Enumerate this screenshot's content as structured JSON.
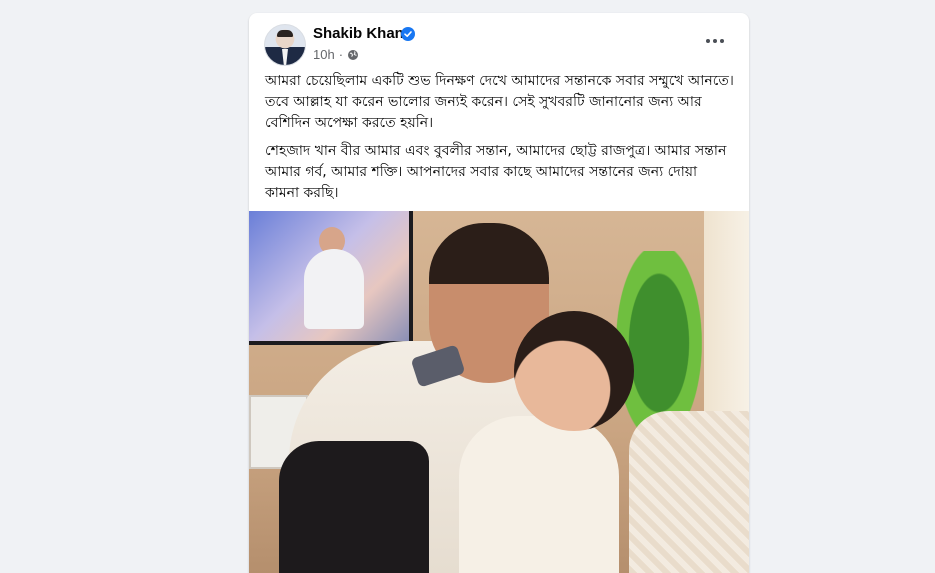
{
  "post": {
    "author": {
      "name": "Shakib Khan",
      "verified": true,
      "avatar_icon": "profile-avatar"
    },
    "meta": {
      "time": "10h",
      "separator": "·",
      "audience_icon": "globe-icon"
    },
    "more_icon": "more-horizontal-icon",
    "text": {
      "paragraph1": "আমরা চেয়েছিলাম একটি শুভ দিনক্ষণ দেখে আমাদের সন্তানকে সবার সম্মুখে আনতে। তবে আল্লাহ যা করেন ভালোর জন্যই করেন। সেই সুখবরটি জানানোর জন্য আর বেশিদিন অপেক্ষা করতে হয়নি।",
      "paragraph2": "শেহজাদ খান বীর আমার এবং বুবলীর সন্তান, আমাদের ছোট্ট রাজপুত্র। আমার সন্তান আমার গর্ব, আমার শক্তি। আপনাদের সবার কাছে আমাদের সন্তানের জন্য দোয়া কামনা করছি।"
    }
  },
  "colors": {
    "page_background": "#f0f2f5",
    "card_background": "#ffffff",
    "verified_badge": "#1877f2",
    "meta_text": "#65676b",
    "body_text": "#050505"
  }
}
